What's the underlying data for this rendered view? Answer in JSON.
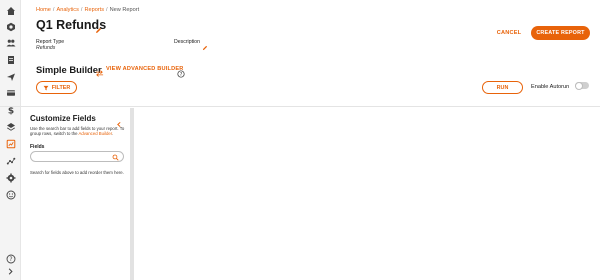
{
  "rail": {
    "icons": [
      "home-icon",
      "dashboard-icon",
      "users-icon",
      "document-icon",
      "send-icon",
      "card-icon",
      "dollar-icon",
      "layers-icon",
      "reports-icon",
      "trend-icon",
      "settings-icon",
      "smile-icon"
    ],
    "active": "reports-icon",
    "bottom": [
      "help-icon",
      "expand-icon"
    ]
  },
  "breadcrumb": {
    "items": [
      "Home",
      "Analytics",
      "Reports",
      "New Report"
    ],
    "separator": "/"
  },
  "report": {
    "title": "Q1 Refunds",
    "type_label": "Report Type",
    "type_value": "Refunds",
    "description_label": "Description"
  },
  "actions": {
    "cancel": "CANCEL",
    "create": "CREATE REPORT"
  },
  "builder": {
    "title": "Simple Builder",
    "advanced_link": "VIEW ADVANCED BUILDER",
    "filter": "FILTER",
    "run": "RUN",
    "autorun_label": "Enable Autorun",
    "autorun_enabled": false
  },
  "panel": {
    "title": "Customize Fields",
    "help_prefix": "Use the search bar to add fields to your report. To group rows, switch to the",
    "help_link": "Advanced Builder",
    "help_suffix": ".",
    "fields_label": "Fields",
    "search_value": "",
    "search_placeholder": "",
    "empty_text": "Search for fields above to add reorder them here."
  },
  "colors": {
    "accent": "#e8630a",
    "rail_bg": "#f4f4f4"
  }
}
